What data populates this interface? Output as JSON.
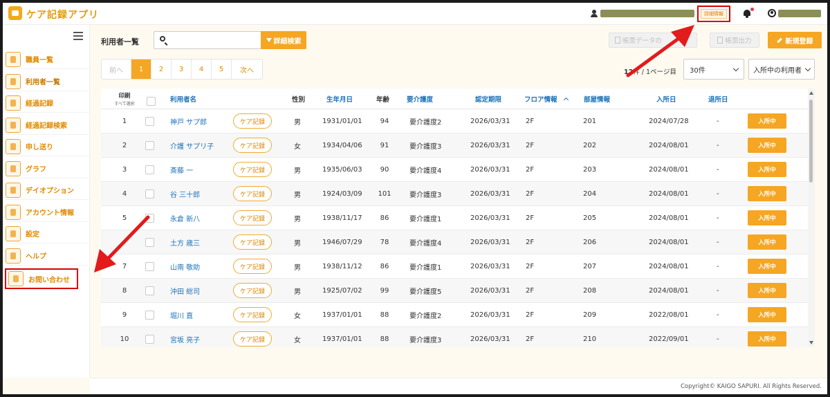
{
  "header": {
    "app_title": "ケア記録アプリ",
    "detail_info_label": "詳細情報"
  },
  "sidebar": {
    "items": [
      {
        "label": "職員一覧",
        "name": "sidebar-item-staff-list"
      },
      {
        "label": "利用者一覧",
        "name": "sidebar-item-user-list"
      },
      {
        "label": "経過記録",
        "name": "sidebar-item-progress-record"
      },
      {
        "label": "経過記録検索",
        "name": "sidebar-item-progress-search"
      },
      {
        "label": "申し送り",
        "name": "sidebar-item-handover"
      },
      {
        "label": "グラフ",
        "name": "sidebar-item-graph"
      },
      {
        "label": "デイオプション",
        "name": "sidebar-item-day-option"
      },
      {
        "label": "アカウント情報",
        "name": "sidebar-item-account-info"
      },
      {
        "label": "設定",
        "name": "sidebar-item-settings"
      },
      {
        "label": "ヘルプ",
        "name": "sidebar-item-help"
      },
      {
        "label": "お問い合わせ",
        "name": "sidebar-item-contact"
      }
    ]
  },
  "toolbar": {
    "page_label": "利用者一覧",
    "search_placeholder": "",
    "detail_search_label": "詳細検索",
    "form_data_label": "帳票データの",
    "form_output_label": "帳票出力",
    "new_label": "新規登録"
  },
  "pagination": {
    "prev": "前へ",
    "pages": [
      "1",
      "2",
      "3",
      "4",
      "5"
    ],
    "current": "1",
    "next": "次へ",
    "info_count": "12",
    "info_rest": "件 / 1ページ目",
    "per_page": "30件",
    "filter": "入所中の利用者"
  },
  "table": {
    "headers": {
      "print": "印刷",
      "select_all": "すべて選択",
      "name": "利用者名",
      "gender": "性別",
      "birth": "生年月日",
      "age": "年齢",
      "care_level": "要介護度",
      "cert_period": "認定期限",
      "floor": "フロア情報",
      "room": "部屋情報",
      "admission": "入所日",
      "discharge": "退所日"
    },
    "care_btn_label": "ケア記録",
    "rows": [
      {
        "no": "1",
        "name": "神戸 サプ郎",
        "gender": "男",
        "birth": "1931/01/01",
        "age": "94",
        "care": "要介護度2",
        "limit": "2026/03/31",
        "floor": "2F",
        "room": "201",
        "admission": "2024/07/28",
        "discharge": "-",
        "status": "入所中"
      },
      {
        "no": "2",
        "name": "介護 サプリ子",
        "gender": "女",
        "birth": "1934/04/06",
        "age": "91",
        "care": "要介護度3",
        "limit": "2026/03/31",
        "floor": "2F",
        "room": "202",
        "admission": "2024/08/01",
        "discharge": "-",
        "status": "入所中"
      },
      {
        "no": "3",
        "name": "斎藤 一",
        "gender": "男",
        "birth": "1935/06/03",
        "age": "90",
        "care": "要介護度4",
        "limit": "2026/03/31",
        "floor": "2F",
        "room": "203",
        "admission": "2024/08/01",
        "discharge": "-",
        "status": "入所中"
      },
      {
        "no": "4",
        "name": "谷 三十郎",
        "gender": "男",
        "birth": "1924/03/09",
        "age": "101",
        "care": "要介護度3",
        "limit": "2026/03/31",
        "floor": "2F",
        "room": "204",
        "admission": "2024/08/01",
        "discharge": "-",
        "status": "入所中"
      },
      {
        "no": "5",
        "name": "永倉 新八",
        "gender": "男",
        "birth": "1938/11/17",
        "age": "86",
        "care": "要介護度1",
        "limit": "2026/03/31",
        "floor": "2F",
        "room": "205",
        "admission": "2024/08/01",
        "discharge": "-",
        "status": "入所中"
      },
      {
        "no": "",
        "name": "土方 歳三",
        "gender": "男",
        "birth": "1946/07/29",
        "age": "78",
        "care": "要介護度4",
        "limit": "2026/03/31",
        "floor": "2F",
        "room": "206",
        "admission": "2024/08/01",
        "discharge": "-",
        "status": "入所中"
      },
      {
        "no": "7",
        "name": "山南 敬助",
        "gender": "男",
        "birth": "1938/11/12",
        "age": "86",
        "care": "要介護度1",
        "limit": "2026/03/31",
        "floor": "2F",
        "room": "207",
        "admission": "2024/08/01",
        "discharge": "-",
        "status": "入所中"
      },
      {
        "no": "8",
        "name": "沖田 総司",
        "gender": "男",
        "birth": "1925/07/02",
        "age": "99",
        "care": "要介護度5",
        "limit": "2026/03/31",
        "floor": "2F",
        "room": "208",
        "admission": "2024/08/01",
        "discharge": "-",
        "status": "入所中"
      },
      {
        "no": "9",
        "name": "堀川 直",
        "gender": "女",
        "birth": "1937/01/01",
        "age": "88",
        "care": "要介護度2",
        "limit": "2026/03/31",
        "floor": "2F",
        "room": "209",
        "admission": "2022/08/01",
        "discharge": "-",
        "status": "入所中"
      },
      {
        "no": "10",
        "name": "宮坂 亮子",
        "gender": "女",
        "birth": "1937/01/01",
        "age": "88",
        "care": "要介護度3",
        "limit": "2026/03/31",
        "floor": "2F",
        "room": "210",
        "admission": "2022/09/01",
        "discharge": "-",
        "status": "入所中"
      }
    ]
  },
  "footer": {
    "copyright": "Copyright© KAIGO SAPURI. All Rights Reserved."
  },
  "colors": {
    "accent": "#f5a623",
    "link": "#1d72b8",
    "annotation": "#d60000"
  }
}
